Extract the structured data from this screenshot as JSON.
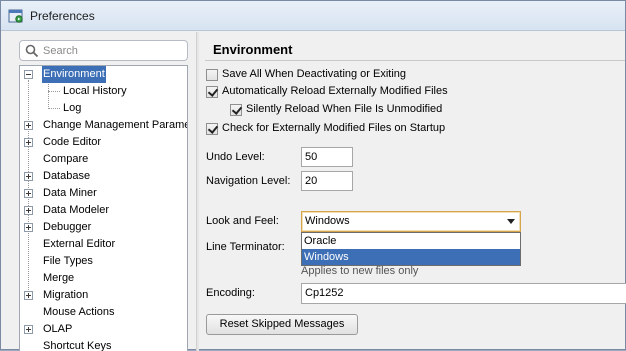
{
  "window": {
    "title": "Preferences"
  },
  "search": {
    "placeholder": "Search"
  },
  "tree": {
    "items": [
      {
        "label": "Environment",
        "expanded": true,
        "selected": true
      },
      {
        "label": "Local History",
        "child": true
      },
      {
        "label": "Log",
        "child": true
      },
      {
        "label": "Change Management Paramet",
        "expandable": true
      },
      {
        "label": "Code Editor",
        "expandable": true
      },
      {
        "label": "Compare"
      },
      {
        "label": "Database",
        "expandable": true
      },
      {
        "label": "Data Miner",
        "expandable": true
      },
      {
        "label": "Data Modeler",
        "expandable": true
      },
      {
        "label": "Debugger",
        "expandable": true
      },
      {
        "label": "External Editor"
      },
      {
        "label": "File Types"
      },
      {
        "label": "Merge"
      },
      {
        "label": "Migration",
        "expandable": true
      },
      {
        "label": "Mouse Actions"
      },
      {
        "label": "OLAP",
        "expandable": true
      },
      {
        "label": "Shortcut Keys"
      }
    ]
  },
  "environment": {
    "title": "Environment",
    "checkboxes": [
      {
        "label": "Save All When Deactivating or Exiting",
        "checked": false
      },
      {
        "label": "Automatically Reload Externally Modified Files",
        "checked": true
      },
      {
        "label": "Silently Reload When File Is Unmodified",
        "checked": true
      },
      {
        "label": "Check for Externally Modified Files on Startup",
        "checked": true
      }
    ],
    "undo_level": {
      "label": "Undo Level:",
      "value": "50"
    },
    "navigation_level": {
      "label": "Navigation Level:",
      "value": "20"
    },
    "look_and_feel": {
      "label": "Look and Feel:",
      "value": "Windows",
      "options": [
        "Oracle",
        "Windows"
      ],
      "highlighted": "Windows"
    },
    "line_terminator": {
      "label": "Line Terminator:",
      "hint": "Applies to new files only"
    },
    "encoding": {
      "label": "Encoding:",
      "value": "Cp1252"
    },
    "reset_button": "Reset Skipped Messages"
  }
}
